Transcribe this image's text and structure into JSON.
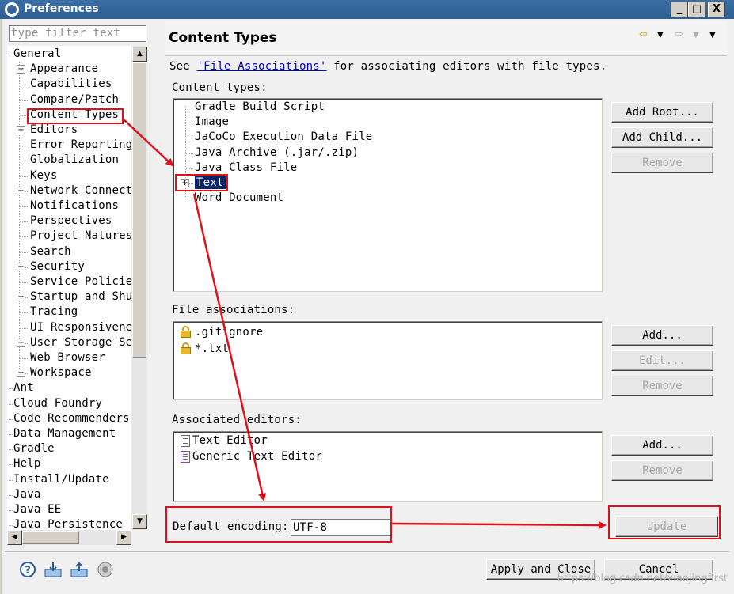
{
  "window": {
    "title": "Preferences",
    "controls": {
      "minimize": "_",
      "maximize": "□",
      "close": "X"
    }
  },
  "filter": {
    "placeholder": "type filter text"
  },
  "tree": {
    "items": [
      {
        "label": "General",
        "level": 0,
        "expanded": true
      },
      {
        "label": "Appearance",
        "level": 1,
        "expandable": true
      },
      {
        "label": "Capabilities",
        "level": 1
      },
      {
        "label": "Compare/Patch",
        "level": 1
      },
      {
        "label": "Content Types",
        "level": 1,
        "selected": true
      },
      {
        "label": "Editors",
        "level": 1,
        "expandable": true
      },
      {
        "label": "Error Reporting",
        "level": 1
      },
      {
        "label": "Globalization",
        "level": 1
      },
      {
        "label": "Keys",
        "level": 1
      },
      {
        "label": "Network Connect",
        "level": 1,
        "expandable": true
      },
      {
        "label": "Notifications",
        "level": 1
      },
      {
        "label": "Perspectives",
        "level": 1
      },
      {
        "label": "Project Natures",
        "level": 1
      },
      {
        "label": "Search",
        "level": 1
      },
      {
        "label": "Security",
        "level": 1,
        "expandable": true
      },
      {
        "label": "Service Policie",
        "level": 1
      },
      {
        "label": "Startup and Shu",
        "level": 1,
        "expandable": true
      },
      {
        "label": "Tracing",
        "level": 1
      },
      {
        "label": "UI Responsivene",
        "level": 1
      },
      {
        "label": "User Storage Se",
        "level": 1,
        "expandable": true
      },
      {
        "label": "Web Browser",
        "level": 1
      },
      {
        "label": "Workspace",
        "level": 1,
        "expandable": true
      },
      {
        "label": "Ant",
        "level": 0
      },
      {
        "label": "Cloud Foundry",
        "level": 0
      },
      {
        "label": "Code Recommenders",
        "level": 0
      },
      {
        "label": "Data Management",
        "level": 0
      },
      {
        "label": "Gradle",
        "level": 0
      },
      {
        "label": "Help",
        "level": 0
      },
      {
        "label": "Install/Update",
        "level": 0
      },
      {
        "label": "Java",
        "level": 0
      },
      {
        "label": "Java EE",
        "level": 0
      },
      {
        "label": "Java Persistence",
        "level": 0
      }
    ]
  },
  "page": {
    "title": "Content Types",
    "intro_prefix": "See ",
    "intro_link": "'File Associations'",
    "intro_suffix": " for associating editors with file types.",
    "content_types_label": "Content types:",
    "content_types": [
      "Gradle Build Script",
      "Image",
      "JaCoCo Execution Data File",
      "Java Archive (.jar/.zip)",
      "Java Class File",
      "Text",
      "Word Document"
    ],
    "content_types_buttons": {
      "add_root": "Add Root...",
      "add_child": "Add Child...",
      "remove": "Remove"
    },
    "file_associations_label": "File associations:",
    "file_associations": [
      ".gitignore",
      "*.txt"
    ],
    "file_assoc_buttons": {
      "add": "Add...",
      "edit": "Edit...",
      "remove": "Remove"
    },
    "associated_editors_label": "Associated editors:",
    "associated_editors": [
      "Text Editor",
      "Generic Text Editor"
    ],
    "editor_buttons": {
      "add": "Add...",
      "remove": "Remove"
    },
    "default_encoding_label": "Default encoding:",
    "default_encoding_value": "UTF-8",
    "update_button": "Update"
  },
  "footer": {
    "apply_close": "Apply and Close",
    "cancel": "Cancel",
    "watermark": "https://blog.csdn.net/xiaojingfirst"
  },
  "colors": {
    "annotation": "#e0101a",
    "selection": "#0a246a",
    "titlebar": "#3a6ea5"
  }
}
